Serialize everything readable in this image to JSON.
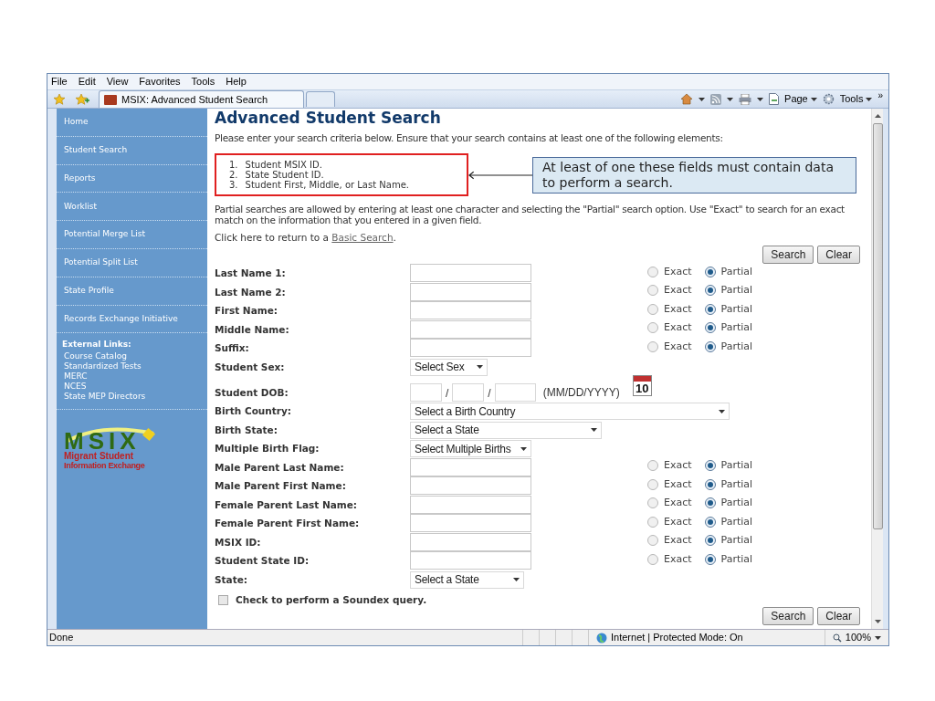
{
  "menu": [
    "File",
    "Edit",
    "View",
    "Favorites",
    "Tools",
    "Help"
  ],
  "tabs": [
    {
      "label": "MSIX: Advanced Student Search",
      "selected": true
    }
  ],
  "toolbar": {
    "page": "Page",
    "tools": "Tools",
    "more": "»"
  },
  "sidebar": {
    "items": [
      {
        "label": "Home"
      },
      {
        "label": "Student Search"
      },
      {
        "label": "Reports"
      },
      {
        "label": "Worklist"
      },
      {
        "label": "Potential Merge List"
      },
      {
        "label": "Potential Split List"
      },
      {
        "label": "State Profile"
      },
      {
        "label": "Records Exchange Initiative"
      }
    ],
    "external_heading": "External Links:",
    "external_links": [
      "Course Catalog",
      "Standardized Tests",
      "MERC",
      "NCES",
      "State MEP Directors"
    ],
    "logo": {
      "letters": "MSIX",
      "line1": "Migrant Student",
      "line2": "Information Exchange"
    }
  },
  "page": {
    "title": "Advanced Student Search",
    "intro": "Please enter your search criteria below. Ensure that your search contains at least one of the following elements:",
    "required": [
      {
        "number": "1.",
        "text": "Student MSIX ID."
      },
      {
        "number": "2.",
        "text": "State Student ID."
      },
      {
        "number": "3.",
        "text": "Student First, Middle, or Last Name."
      }
    ],
    "callout": "At least of one these fields must contain data to perform a search.",
    "partial_note": "Partial searches are allowed by entering at least one character and selecting the \"Partial\" search option. Use \"Exact\" to search for an exact match on the information that you entered in a given field.",
    "return_prefix": "Click here to return to a ",
    "return_link": "Basic Search",
    "return_suffix": ".",
    "buttons": [
      "Search",
      "Clear"
    ],
    "bottom_buttons": [
      "Search",
      "Clear"
    ],
    "fields": [
      {
        "label": "Last Name 1:",
        "kind": "text",
        "match": [
          {
            "label": "Exact",
            "selected": false
          },
          {
            "label": "Partial",
            "selected": true
          }
        ]
      },
      {
        "label": "Last Name 2:",
        "kind": "text",
        "match": [
          {
            "label": "Exact",
            "selected": false
          },
          {
            "label": "Partial",
            "selected": true
          }
        ]
      },
      {
        "label": "First Name:",
        "kind": "text",
        "match": [
          {
            "label": "Exact",
            "selected": false
          },
          {
            "label": "Partial",
            "selected": true
          }
        ]
      },
      {
        "label": "Middle Name:",
        "kind": "text",
        "match": [
          {
            "label": "Exact",
            "selected": false
          },
          {
            "label": "Partial",
            "selected": true
          }
        ]
      },
      {
        "label": "Suffix:",
        "kind": "text",
        "match": [
          {
            "label": "Exact",
            "selected": false
          },
          {
            "label": "Partial",
            "selected": true
          }
        ]
      },
      {
        "label": "Student Sex:",
        "kind": "select",
        "value": "Select Sex"
      },
      {
        "label": "Student DOB:",
        "kind": "date",
        "separators": [
          "/",
          "/"
        ],
        "hint": "(MM/DD/YYYY)",
        "calendar_day": "10"
      },
      {
        "label": "Birth Country:",
        "kind": "select",
        "value": "Select a Birth Country"
      },
      {
        "label": "Birth State:",
        "kind": "select",
        "value": "Select a State"
      },
      {
        "label": "Multiple Birth Flag:",
        "kind": "select",
        "value": "Select Multiple Births"
      },
      {
        "label": "Male Parent Last Name:",
        "kind": "text",
        "match": [
          {
            "label": "Exact",
            "selected": false
          },
          {
            "label": "Partial",
            "selected": true
          }
        ]
      },
      {
        "label": "Male Parent First Name:",
        "kind": "text",
        "match": [
          {
            "label": "Exact",
            "selected": false
          },
          {
            "label": "Partial",
            "selected": true
          }
        ]
      },
      {
        "label": "Female Parent Last Name:",
        "kind": "text",
        "match": [
          {
            "label": "Exact",
            "selected": false
          },
          {
            "label": "Partial",
            "selected": true
          }
        ]
      },
      {
        "label": "Female Parent First Name:",
        "kind": "text",
        "match": [
          {
            "label": "Exact",
            "selected": false
          },
          {
            "label": "Partial",
            "selected": true
          }
        ]
      },
      {
        "label": "MSIX ID:",
        "kind": "text",
        "match": [
          {
            "label": "Exact",
            "selected": false
          },
          {
            "label": "Partial",
            "selected": true
          }
        ]
      },
      {
        "label": "Student State ID:",
        "kind": "text",
        "match": [
          {
            "label": "Exact",
            "selected": false
          },
          {
            "label": "Partial",
            "selected": true
          }
        ]
      },
      {
        "label": "State:",
        "kind": "select",
        "value": "Select a State"
      }
    ],
    "soundex": {
      "label": "Check to perform a Soundex query.",
      "checked": false
    }
  },
  "status_bar": {
    "text": "Done",
    "zone": "Internet | Protected Mode: On",
    "zoom": "100%"
  }
}
